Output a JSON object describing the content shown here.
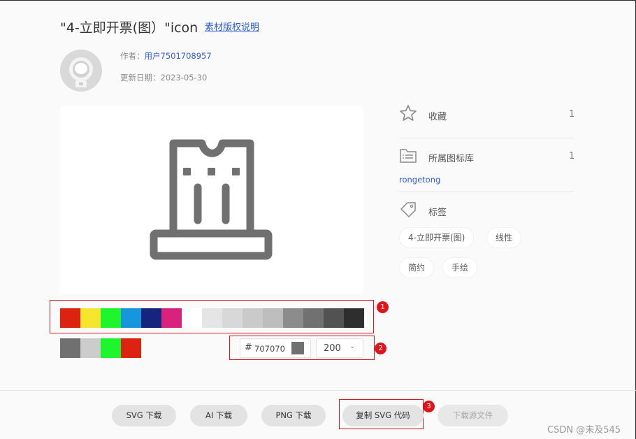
{
  "header": {
    "title": "\"4-立即开票(图）\"icon",
    "copyright_link": "素材版权说明"
  },
  "meta": {
    "author_label": "作者：",
    "author_name": "用户7501708957",
    "updated_label": "更新日期：",
    "updated_date": "2023-05-30"
  },
  "palette": {
    "swatches": [
      "#dd2211",
      "#f5e52c",
      "#1ff52c",
      "#1896dd",
      "#15247d",
      "#d8227d",
      "#ffffff",
      "#e5e5e5",
      "#d8d8d8",
      "#cacaca",
      "#bdbdbd",
      "#8c8c8c",
      "#717171",
      "#525252",
      "#2e2e2e"
    ],
    "recent": [
      "#707070",
      "#cccccc",
      "#1ff52c",
      "#dd2211"
    ],
    "badge_1": "1"
  },
  "color_picker": {
    "hash": "#",
    "hex_value": "707070",
    "chip_color": "#707070",
    "size_value": "200",
    "badge_2": "2"
  },
  "sidebar": {
    "favorite_label": "收藏",
    "favorite_count": "1",
    "library_label": "所属图标库",
    "library_count": "1",
    "library_name": "rongetong",
    "tags_label": "标签",
    "tags": [
      "4-立即开票(图)",
      "线性",
      "简约",
      "手绘"
    ]
  },
  "footer": {
    "buttons": [
      "SVG 下载",
      "AI 下载",
      "PNG 下载",
      "复制 SVG 代码",
      "下载源文件"
    ],
    "badge_3": "3"
  },
  "watermark": "CSDN @未及545",
  "icon_color": "#707070",
  "accent_color": "#2b5bd6",
  "highlight_color": "#e0151b"
}
